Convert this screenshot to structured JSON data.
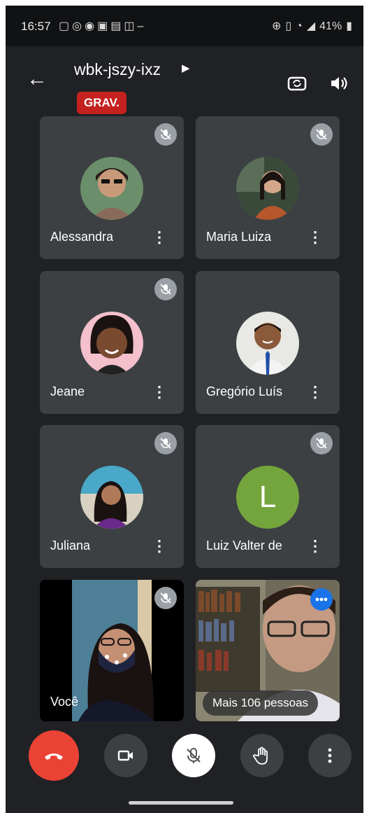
{
  "status_bar": {
    "time": "16:57",
    "left_icons": [
      "screen-record-icon",
      "whatsapp-icon",
      "messenger-icon",
      "facebook-icon",
      "gallery-icon",
      "instagram-icon",
      "minus-icon"
    ],
    "battery": "41%"
  },
  "header": {
    "meeting_code": "wbk-jszy-ixz",
    "recording_badge": "GRAV."
  },
  "participants": [
    {
      "name": "Alessandra",
      "avatar_color": "#6b8e6b"
    },
    {
      "name": "Maria Luiza",
      "avatar_color": "#9b5a3a"
    },
    {
      "name": "Jeane",
      "avatar_color": "#2b1a14"
    },
    {
      "name": "Gregório Luís",
      "avatar_color": "#5b3a2a"
    },
    {
      "name": "Juliana",
      "avatar_color": "#3a2a4a"
    },
    {
      "name": "Luiz Valter de",
      "avatar_letter": "L",
      "avatar_color": "#74a53c"
    }
  ],
  "self_tile": {
    "label": "Você"
  },
  "more_tile": {
    "label": "Mais 106 pessoas"
  },
  "colors": {
    "background": "#202124",
    "tile": "#3c4043",
    "hangup": "#ea4335",
    "recording": "#c5221f",
    "accent_blue": "#1a73e8"
  }
}
